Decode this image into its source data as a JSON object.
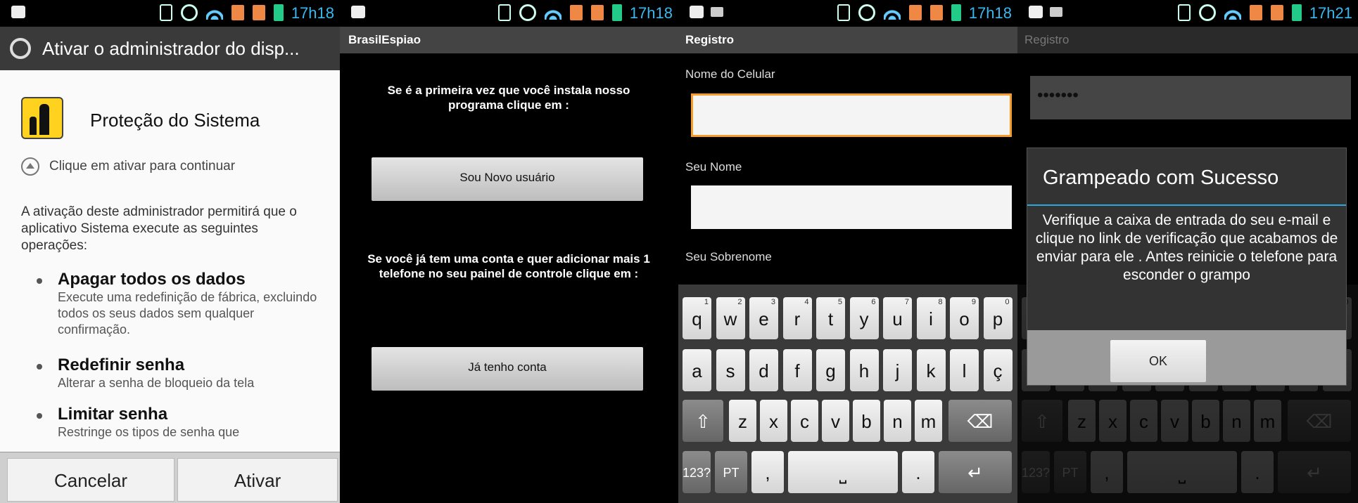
{
  "status": {
    "time1": "17h18",
    "time2": "17h18",
    "time3": "17h18",
    "time4": "17h21"
  },
  "screen1": {
    "title": "Ativar o administrador do disp...",
    "app_name": "Proteção do Sistema",
    "hint": "Clique em ativar para continuar",
    "description": "A ativação deste administrador permitirá que o aplicativo Sistema execute as seguintes operações:",
    "permissions": [
      {
        "title": "Apagar todos os dados",
        "desc": "Execute uma redefinição de fábrica, excluindo todos os seus dados sem qualquer confirmação."
      },
      {
        "title": "Redefinir senha",
        "desc": "Alterar a senha de bloqueio da tela"
      },
      {
        "title": "Limitar senha",
        "desc": "Restringe os tipos de senha que"
      }
    ],
    "cancel_label": "Cancelar",
    "activate_label": "Ativar"
  },
  "screen2": {
    "app_title": "BrasilEspiao",
    "msg1": "Se é a primeira vez que você instala nosso programa clique em :",
    "new_user_label": "Sou Novo usuário",
    "msg2": "Se você já tem uma conta e quer adicionar mais 1 telefone no seu painel de controle clique em :",
    "have_account_label": "Já tenho conta"
  },
  "screen3": {
    "title": "Registro",
    "label_phone_name": "Nome do Celular",
    "label_your_name": "Seu Nome",
    "label_surname": "Seu Sobrenome"
  },
  "keyboard": {
    "row1": [
      "q",
      "w",
      "e",
      "r",
      "t",
      "y",
      "u",
      "i",
      "o",
      "p"
    ],
    "row1_nums": [
      "1",
      "2",
      "3",
      "4",
      "5",
      "6",
      "7",
      "8",
      "9",
      "0"
    ],
    "row2": [
      "a",
      "s",
      "d",
      "f",
      "g",
      "h",
      "j",
      "k",
      "l",
      "ç"
    ],
    "row3": [
      "z",
      "x",
      "c",
      "v",
      "b",
      "n",
      "m"
    ],
    "shift": "⇧",
    "backspace": "⌫",
    "sym": "123?",
    "sym_top": "☺",
    "lang": "PT",
    "comma": ",",
    "space": "⎵",
    "period": ".",
    "enter": "↵"
  },
  "screen4": {
    "title": "Registro",
    "password_value": "•••••••",
    "dialog_title": "Grampeado com Sucesso",
    "dialog_body": "Verifique a caixa de entrada do seu e-mail e clique no link de verificação que acabamos de enviar para ele . Antes reinicie o telefone para esconder o grampo",
    "ok_label": "OK"
  }
}
